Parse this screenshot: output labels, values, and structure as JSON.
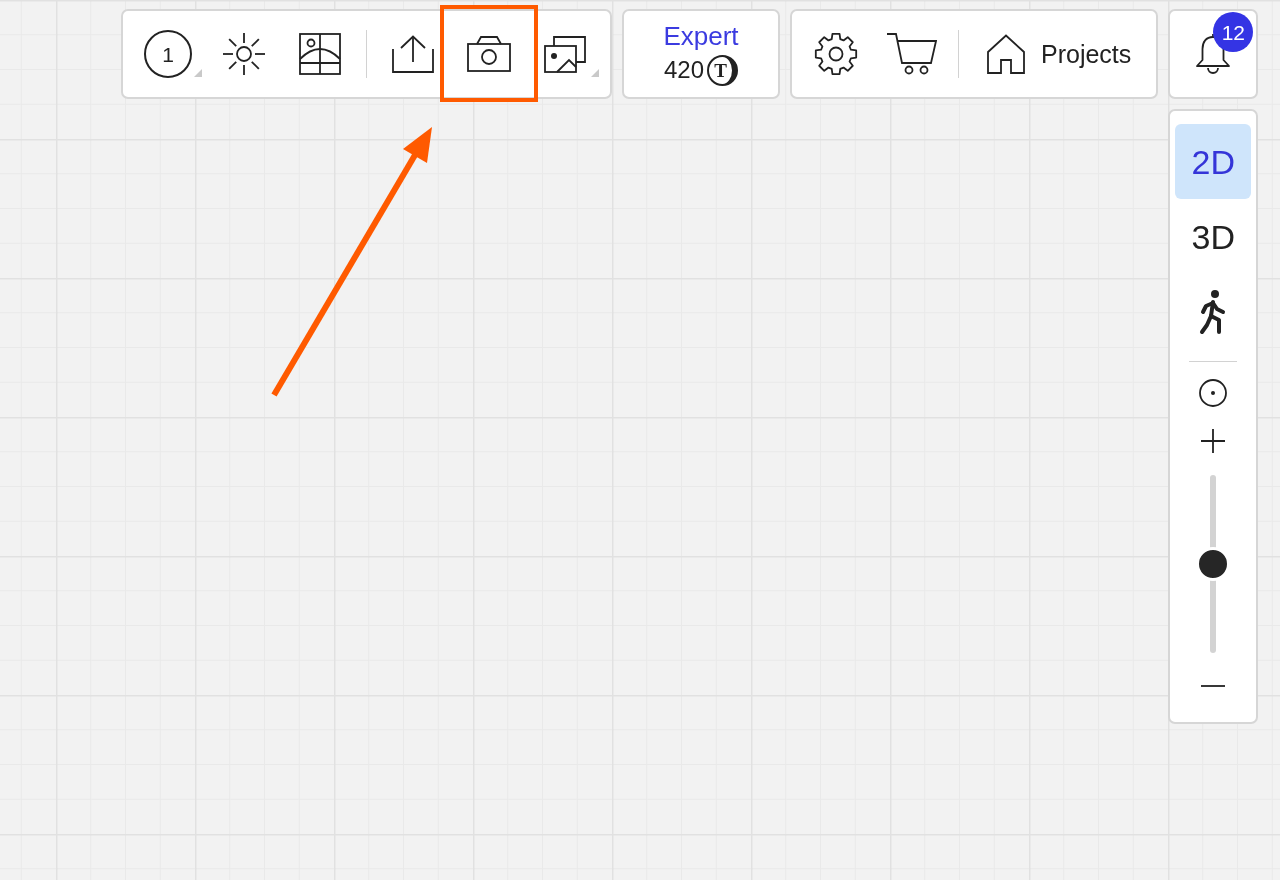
{
  "main_toolbar": {
    "groups": [
      {
        "buttons": [
          {
            "kind": "level",
            "label": "1",
            "menu": true,
            "highlighted": false
          },
          {
            "kind": "sun",
            "menu": false,
            "highlighted": false
          },
          {
            "kind": "plan",
            "menu": false,
            "highlighted": false
          }
        ]
      },
      {
        "buttons": [
          {
            "kind": "upload",
            "menu": false,
            "highlighted": false
          },
          {
            "kind": "camera",
            "menu": false,
            "highlighted": true
          },
          {
            "kind": "gallery",
            "menu": true,
            "highlighted": false
          }
        ]
      }
    ]
  },
  "account": {
    "plan": "Expert",
    "balance": "420",
    "currency": "T"
  },
  "nav_toolbar": {
    "groups": [
      {
        "buttons": [
          {
            "kind": "settings"
          },
          {
            "kind": "cart"
          }
        ]
      },
      {
        "buttons": [
          {
            "kind": "home",
            "label": "Projects"
          }
        ]
      }
    ]
  },
  "notifications": {
    "count": "12"
  },
  "view_panel": {
    "modes": [
      {
        "kind": "text",
        "label": "2D",
        "selected": true
      },
      {
        "kind": "text",
        "label": "3D",
        "selected": false
      },
      {
        "kind": "walk",
        "selected": false
      }
    ],
    "zoom": {
      "level": 0.5
    }
  }
}
